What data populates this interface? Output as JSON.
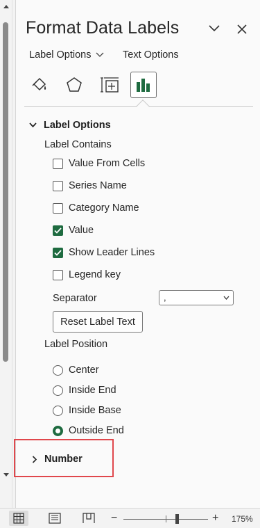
{
  "pane": {
    "title": "Format Data Labels",
    "tabs": {
      "label_options": "Label Options",
      "text_options": "Text Options"
    }
  },
  "label_options": {
    "header": "Label Options",
    "contains_label": "Label Contains",
    "checkboxes": [
      {
        "label": "Value From Cells",
        "checked": false
      },
      {
        "label": "Series Name",
        "checked": false
      },
      {
        "label": "Category Name",
        "checked": false
      },
      {
        "label": "Value",
        "checked": true
      },
      {
        "label": "Show Leader Lines",
        "checked": true
      },
      {
        "label": "Legend key",
        "checked": false
      }
    ],
    "separator_label": "Separator",
    "separator_value": ",",
    "reset_button": "Reset Label Text",
    "position_label": "Label Position",
    "positions": [
      {
        "label": "Center",
        "selected": false
      },
      {
        "label": "Inside End",
        "selected": false
      },
      {
        "label": "Inside Base",
        "selected": false
      },
      {
        "label": "Outside End",
        "selected": true
      }
    ]
  },
  "number_section": {
    "header": "Number"
  },
  "status_bar": {
    "zoom_level": "175%"
  },
  "colors": {
    "accent": "#1e6b40",
    "highlight": "#e0474c"
  }
}
